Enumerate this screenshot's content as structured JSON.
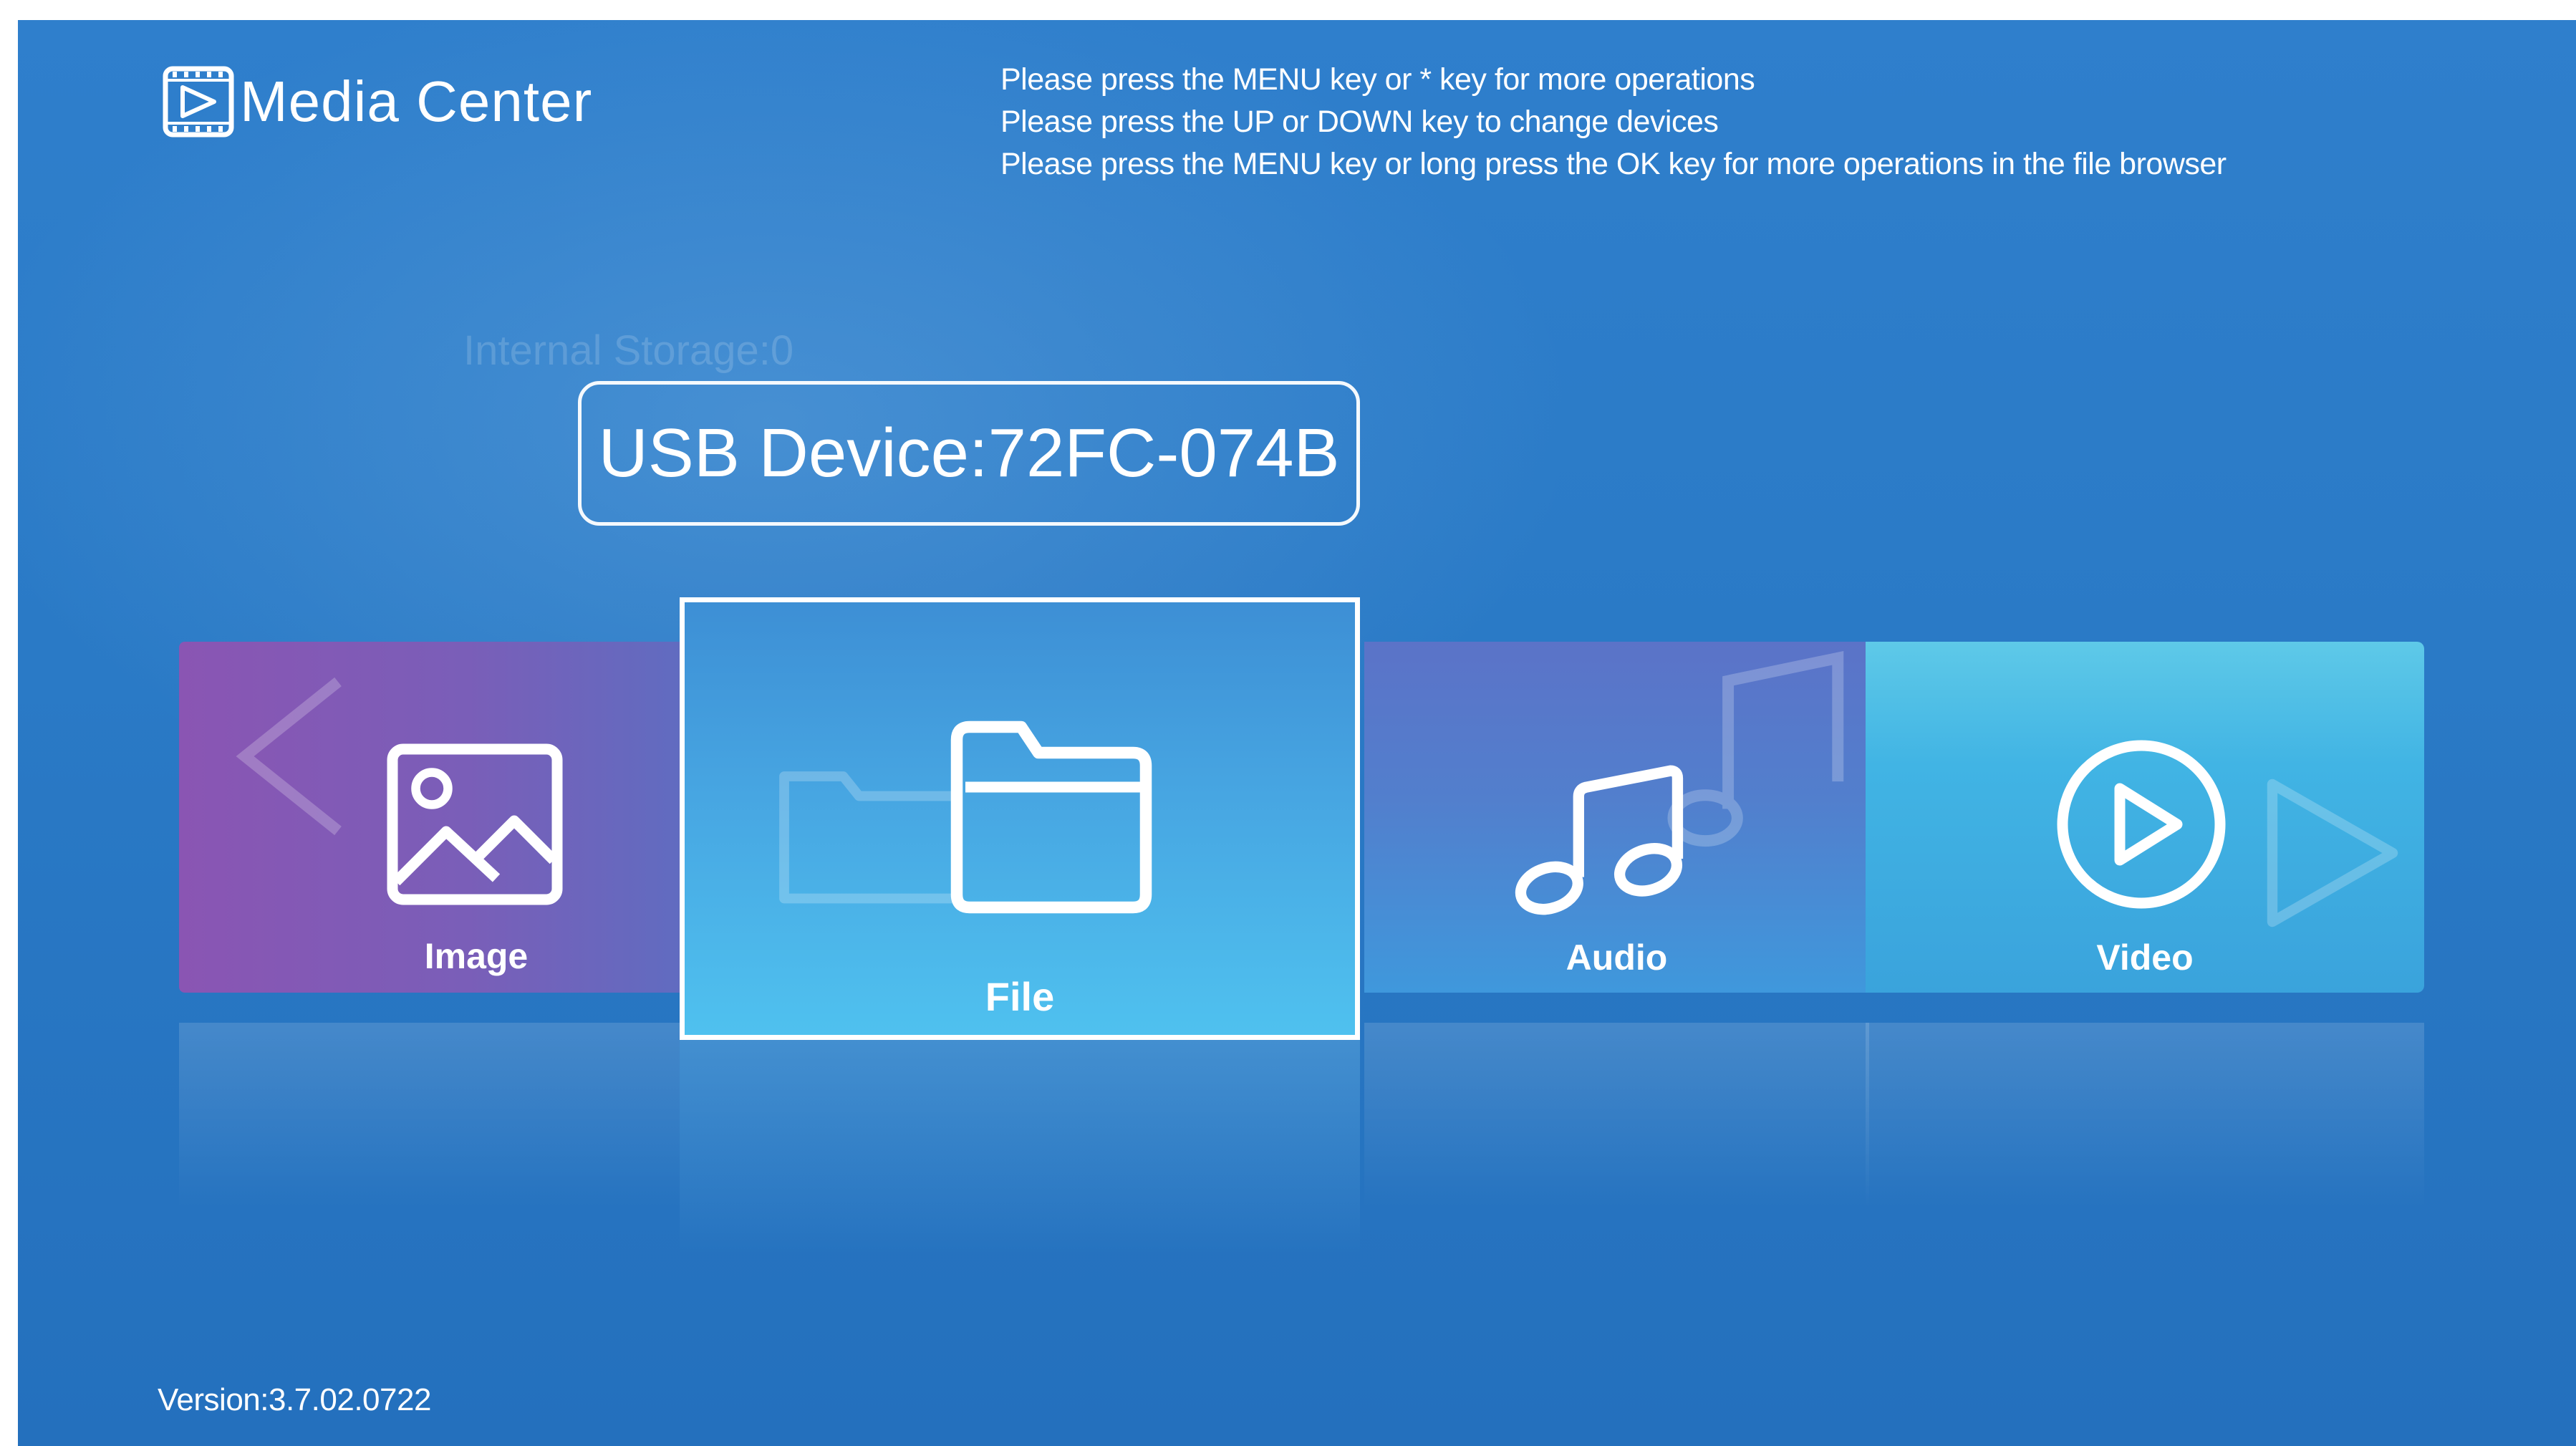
{
  "header": {
    "app_title": "Media Center",
    "logo_icon": "film-play-icon",
    "hints": [
      "Please press the MENU key or * key for more operations",
      "Please press the UP or DOWN key to change devices",
      "Please press the MENU key or long press the OK key for more operations in the file browser"
    ]
  },
  "devices": {
    "previous": "Internal Storage:0",
    "current": "USB Device:72FC-074B"
  },
  "tiles": [
    {
      "label": "Image",
      "icon": "picture-icon",
      "selected": false
    },
    {
      "label": "File",
      "icon": "folder-icon",
      "selected": true
    },
    {
      "label": "Audio",
      "icon": "music-note-icon",
      "selected": false
    },
    {
      "label": "Video",
      "icon": "play-circle-icon",
      "selected": false
    }
  ],
  "footer": {
    "version": "Version:3.7.02.0722"
  },
  "colors": {
    "background": "#2a7ac6",
    "image_tile": "#8a55b3",
    "file_tile": "#47a6e2",
    "audio_tile": "#527fcd",
    "video_tile": "#41b4e4",
    "selection_border": "#ffffff"
  }
}
